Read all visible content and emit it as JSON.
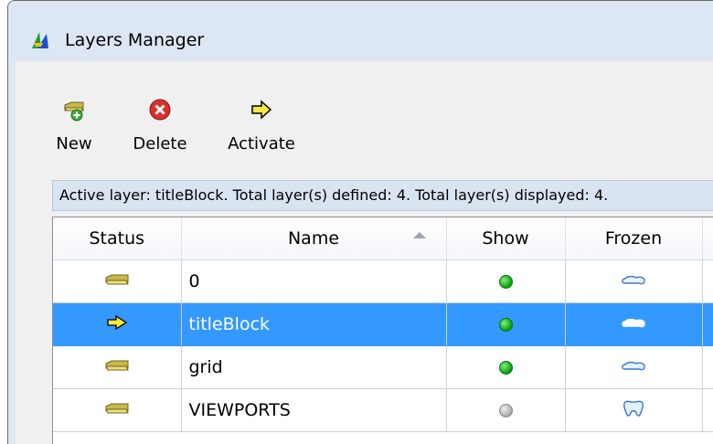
{
  "window": {
    "title": "Layers Manager"
  },
  "toolbar": {
    "new_label": "New",
    "delete_label": "Delete",
    "activate_label": "Activate"
  },
  "status": {
    "text": "Active layer: titleBlock. Total layer(s) defined: 4. Total layer(s) displayed: 4."
  },
  "columns": {
    "status": "Status",
    "name": "Name",
    "show": "Show",
    "frozen": "Frozen"
  },
  "rows": [
    {
      "name": "0",
      "status_icon": "folder-icon",
      "show": "green-dot",
      "frozen": "cloud-icon",
      "selected": false
    },
    {
      "name": "titleBlock",
      "status_icon": "arrow-right-icon",
      "show": "green-dot",
      "frozen": "cloud-icon",
      "selected": true
    },
    {
      "name": "grid",
      "status_icon": "folder-icon",
      "show": "green-dot",
      "frozen": "cloud-icon",
      "selected": false
    },
    {
      "name": "VIEWPORTS",
      "status_icon": "folder-icon",
      "show": "gray-dot",
      "frozen": "tooth-icon",
      "selected": false
    }
  ],
  "colors": {
    "selection": "#3399ff",
    "titlebar": "#dde7f3",
    "statusbar": "#d9e4f1",
    "show_on": "#0a9c0a",
    "show_off": "#a8a8a8"
  }
}
